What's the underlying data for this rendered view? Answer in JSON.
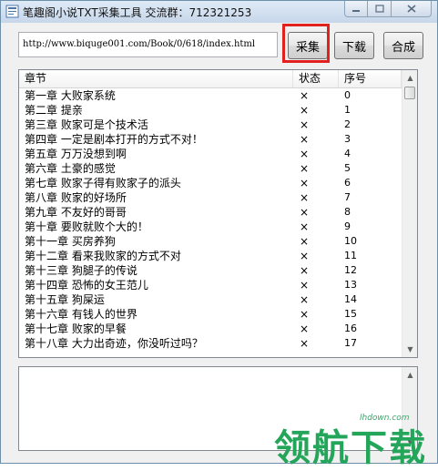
{
  "window": {
    "title": "笔趣阁小说TXT采集工具   交流群：712321253"
  },
  "toolbar": {
    "url_value": "http://www.biquge001.com/Book/0/618/index.html",
    "collect_label": "采集",
    "download_label": "下载",
    "merge_label": "合成"
  },
  "list": {
    "columns": [
      "章节",
      "状态",
      "序号"
    ],
    "rows": [
      {
        "chapter": "第一章 大败家系统",
        "status": "×",
        "index": "0"
      },
      {
        "chapter": "第二章 提亲",
        "status": "×",
        "index": "1"
      },
      {
        "chapter": "第三章 败家可是个技术活",
        "status": "×",
        "index": "2"
      },
      {
        "chapter": "第四章 一定是剧本打开的方式不对！",
        "status": "×",
        "index": "3"
      },
      {
        "chapter": "第五章 万万没想到啊",
        "status": "×",
        "index": "4"
      },
      {
        "chapter": "第六章 土豪的感觉",
        "status": "×",
        "index": "5"
      },
      {
        "chapter": "第七章 败家子得有败家子的派头",
        "status": "×",
        "index": "6"
      },
      {
        "chapter": "第八章 败家的好场所",
        "status": "×",
        "index": "7"
      },
      {
        "chapter": "第九章 不友好的哥哥",
        "status": "×",
        "index": "8"
      },
      {
        "chapter": "第十章 要败就败个大的！",
        "status": "×",
        "index": "9"
      },
      {
        "chapter": "第十一章 买房养狗",
        "status": "×",
        "index": "10"
      },
      {
        "chapter": "第十二章 看来我败家的方式不对",
        "status": "×",
        "index": "11"
      },
      {
        "chapter": "第十三章 狗腿子的传说",
        "status": "×",
        "index": "12"
      },
      {
        "chapter": "第十四章 恐怖的女王范儿",
        "status": "×",
        "index": "13"
      },
      {
        "chapter": "第十五章 狗屎运",
        "status": "×",
        "index": "14"
      },
      {
        "chapter": "第十六章 有钱人的世界",
        "status": "×",
        "index": "15"
      },
      {
        "chapter": "第十七章 败家的早餐",
        "status": "×",
        "index": "16"
      },
      {
        "chapter": "第十八章 大力出奇迹，你没听过吗？",
        "status": "×",
        "index": "17"
      }
    ]
  },
  "watermark": {
    "url": "lhdown.com",
    "brand": "领航下载"
  },
  "colors": {
    "highlight_border": "#e0211e",
    "watermark_green": "#23a55a"
  }
}
